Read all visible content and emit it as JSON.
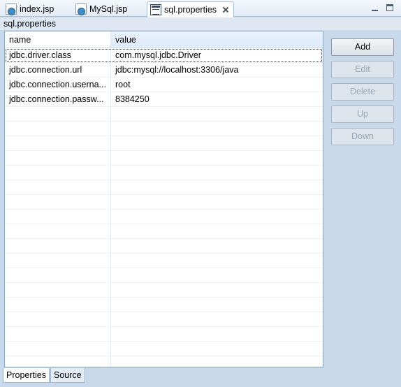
{
  "tabs": [
    {
      "label": "index.jsp",
      "icon": "jsp-file-icon"
    },
    {
      "label": "MySql.jsp",
      "icon": "jsp-file-icon"
    },
    {
      "label": "sql.properties",
      "icon": "properties-file-icon",
      "active": true
    }
  ],
  "editor_title": "sql.properties",
  "table": {
    "columns": [
      "name",
      "value"
    ],
    "rows": [
      {
        "name": "jdbc.driver.class",
        "value": "com.mysql.jdbc.Driver"
      },
      {
        "name": "jdbc.connection.url",
        "value": "jdbc:mysql://localhost:3306/java"
      },
      {
        "name": "jdbc.connection.userna...",
        "value": "root"
      },
      {
        "name": "jdbc.connection.passw...",
        "value": "8384250"
      }
    ]
  },
  "buttons": {
    "add": "Add",
    "edit": "Edit",
    "delete": "Delete",
    "up": "Up",
    "down": "Down"
  },
  "bottom_tabs": [
    "Properties",
    "Source"
  ],
  "colors": {
    "background": "#c8d9ec",
    "header_highlight": "#dceafa"
  }
}
